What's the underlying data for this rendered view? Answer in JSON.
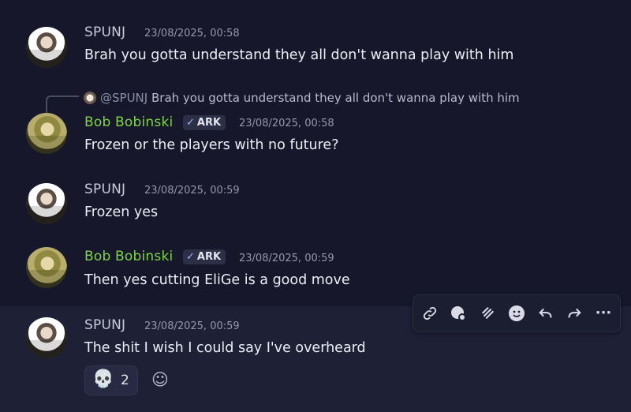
{
  "messages": [
    {
      "author": "SPUNJ",
      "timestamp": "23/08/2025, 00:58",
      "text": "Brah you gotta understand they all don't wanna play with him"
    },
    {
      "author": "Bob Bobinski",
      "tag": "ARK",
      "timestamp": "23/08/2025, 00:58",
      "text": "Frozen or the players with no future?",
      "reply": {
        "mention": "@SPUNJ",
        "text": "Brah you gotta understand they all don't wanna play with him"
      }
    },
    {
      "author": "SPUNJ",
      "timestamp": "23/08/2025, 00:59",
      "text": "Frozen yes"
    },
    {
      "author": "Bob Bobinski",
      "tag": "ARK",
      "timestamp": "23/08/2025, 00:59",
      "text": "Then yes cutting EliGe is a good move"
    },
    {
      "author": "SPUNJ",
      "timestamp": "23/08/2025, 00:59",
      "text": "The shit I wish I could say I've overheard",
      "reactions": [
        {
          "emoji": "skull",
          "count": "2"
        }
      ]
    }
  ],
  "toolbar": {
    "icons": [
      "link-icon",
      "app-icon",
      "thread-icon",
      "emoji-icon",
      "reply-icon",
      "forward-icon",
      "more-icon"
    ],
    "more_label": "···"
  },
  "colors": {
    "background": "#16172a",
    "hover": "#1e2036",
    "bob_name": "#7fd44a",
    "text": "#eceef5"
  }
}
